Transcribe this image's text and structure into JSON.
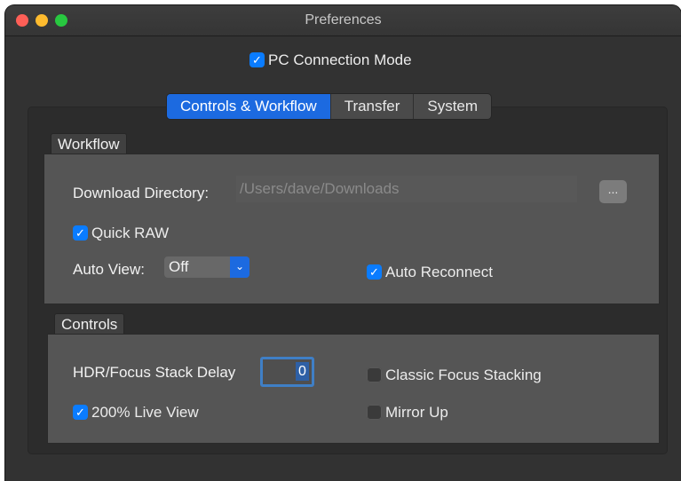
{
  "window": {
    "title": "Preferences"
  },
  "pc_connection_mode": {
    "label": "PC Connection Mode",
    "checked": true
  },
  "tabs": [
    {
      "label": "Controls & Workflow",
      "active": true
    },
    {
      "label": "Transfer",
      "active": false
    },
    {
      "label": "System",
      "active": false
    }
  ],
  "workflow": {
    "title": "Workflow",
    "download_directory_label": "Download Directory:",
    "download_directory_value": "/Users/dave/Downloads",
    "browse_label": "...",
    "quick_raw": {
      "label": "Quick RAW",
      "checked": true
    },
    "auto_view_label": "Auto View:",
    "auto_view_value": "Off",
    "auto_reconnect": {
      "label": "Auto Reconnect",
      "checked": true
    }
  },
  "controls": {
    "title": "Controls",
    "hdr_delay_label": "HDR/Focus Stack Delay",
    "hdr_delay_value": "0",
    "classic_focus_stacking": {
      "label": "Classic Focus Stacking",
      "checked": false
    },
    "live_view_200": {
      "label": "200% Live View",
      "checked": true
    },
    "mirror_up": {
      "label": "Mirror Up",
      "checked": false
    }
  },
  "icons": {
    "check": "checkmark-icon",
    "chevron": "chevron-down-icon"
  },
  "colors": {
    "accent": "#1c6ae0",
    "checkbox": "#0a7cff",
    "window_bg": "#323232",
    "group_bg": "#555555"
  }
}
